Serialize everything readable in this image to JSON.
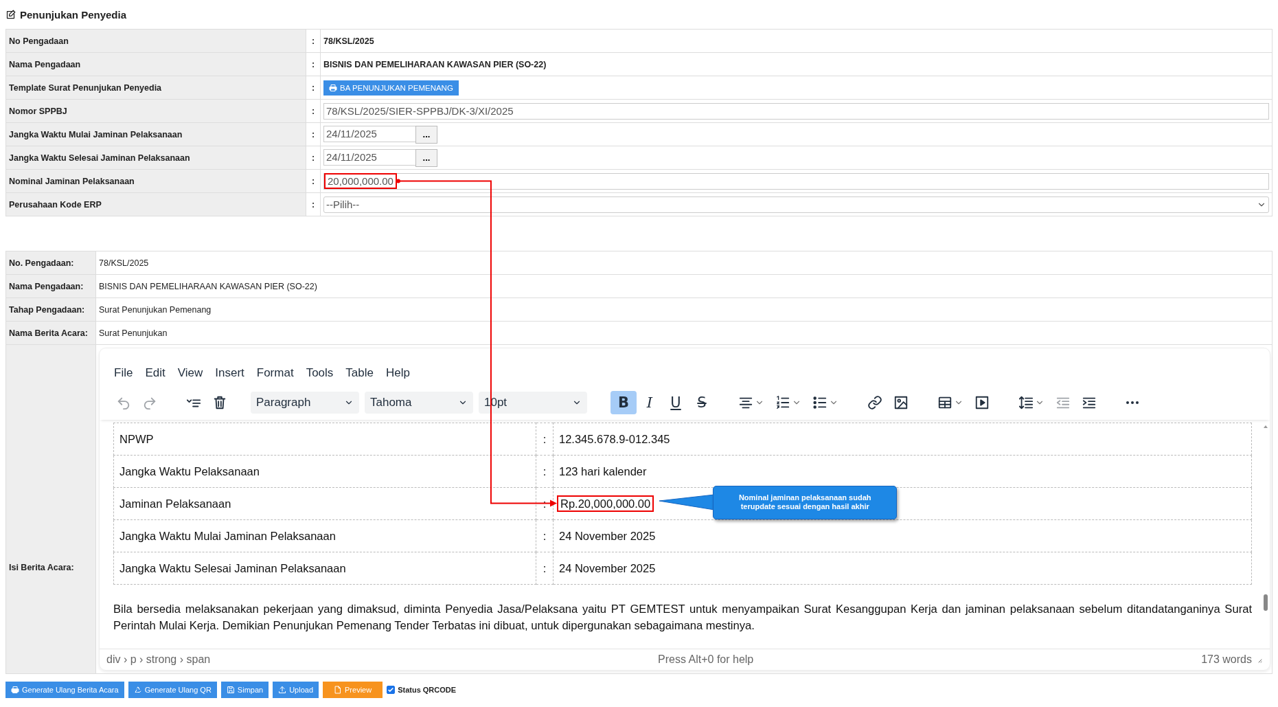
{
  "title": "Penunjukan Penyedia",
  "form": {
    "rows": [
      {
        "kind": "text",
        "label": "No Pengadaan",
        "sep": ":",
        "value": "78/KSL/2025"
      },
      {
        "kind": "text",
        "label": "Nama Pengadaan",
        "sep": ":",
        "value": "BISNIS DAN PEMELIHARAAN KAWASAN PIER (SO-22)"
      },
      {
        "kind": "button",
        "label": "Template Surat Penunjukan Penyedia",
        "sep": ":",
        "button": "BA PENUNJUKAN PEMENANG"
      },
      {
        "kind": "input",
        "label": "Nomor SPPBJ",
        "sep": ":",
        "value": "78/KSL/2025/SIER-SPPBJ/DK-3/XI/2025",
        "highlighted": false
      },
      {
        "kind": "date",
        "label": "Jangka Waktu Mulai Jaminan Pelaksanaan",
        "sep": ":",
        "value": "24/11/2025",
        "button": "..."
      },
      {
        "kind": "date",
        "label": "Jangka Waktu Selesai Jaminan Pelaksanaan",
        "sep": ":",
        "value": "24/11/2025",
        "button": "..."
      },
      {
        "kind": "input",
        "label": "Nominal Jaminan Pelaksanaan",
        "sep": ":",
        "value": "20,000,000.00",
        "highlighted": true
      },
      {
        "kind": "select",
        "label": "Perusahaan Kode ERP",
        "sep": ":",
        "value": "--Pilih--"
      }
    ]
  },
  "info": {
    "rows": [
      {
        "label": "No. Pengadaan:",
        "value": "78/KSL/2025"
      },
      {
        "label": "Nama Pengadaan:",
        "value": "BISNIS DAN PEMELIHARAAN KAWASAN PIER (SO-22)"
      },
      {
        "label": "Tahap Pengadaan:",
        "value": "Surat Penunjukan Pemenang"
      },
      {
        "label": "Nama Berita Acara:",
        "value": "Surat Penunjukan"
      }
    ],
    "editor_label": "Isi Berita Acara:"
  },
  "editor": {
    "menu": [
      "File",
      "Edit",
      "View",
      "Insert",
      "Format",
      "Tools",
      "Table",
      "Help"
    ],
    "toolbar": [
      {
        "kind": "undo",
        "disabled": true
      },
      {
        "kind": "redo",
        "disabled": true
      },
      {
        "kind": "collapse",
        "disabled": false
      },
      {
        "kind": "delete",
        "disabled": false
      },
      {
        "kind": "select",
        "value": "Paragraph"
      },
      {
        "kind": "select",
        "value": "Tahoma"
      },
      {
        "kind": "select",
        "value": "10pt"
      },
      {
        "kind": "bold",
        "label": "B",
        "selected": true
      },
      {
        "kind": "italic",
        "label": "I",
        "selected": false
      },
      {
        "kind": "underline",
        "label": "U",
        "selected": false
      },
      {
        "kind": "strike",
        "label": "S",
        "selected": false
      },
      {
        "kind": "align",
        "disabled": false
      },
      {
        "kind": "numlist",
        "disabled": false
      },
      {
        "kind": "bullist",
        "disabled": false
      },
      {
        "kind": "link",
        "disabled": false
      },
      {
        "kind": "image",
        "disabled": false
      },
      {
        "kind": "table",
        "disabled": false
      },
      {
        "kind": "media",
        "disabled": false
      },
      {
        "kind": "lineheight",
        "disabled": false
      },
      {
        "kind": "outdent",
        "disabled": true
      },
      {
        "kind": "indent",
        "disabled": false
      },
      {
        "kind": "more",
        "disabled": false
      }
    ],
    "rows": [
      {
        "label": "NPWP",
        "sep": ":",
        "value": "12.345.678.9-012.345",
        "highlighted": false
      },
      {
        "label": "Jangka Waktu Pelaksanaan",
        "sep": ":",
        "value": "123 hari kalender",
        "highlighted": false
      },
      {
        "label": "Jaminan Pelaksanaan",
        "sep": ":",
        "value": "Rp.20,000,000.00",
        "highlighted": true
      },
      {
        "label": "Jangka Waktu Mulai Jaminan Pelaksanaan",
        "sep": ":",
        "value": "24 November 2025",
        "highlighted": false
      },
      {
        "label": "Jangka Waktu Selesai Jaminan Pelaksanaan",
        "sep": ":",
        "value": "24 November 2025",
        "highlighted": false
      }
    ],
    "paragraph": "Bila bersedia melaksanakan pekerjaan yang dimaksud, diminta Penyedia Jasa/Pelaksana yaitu PT GEMTEST untuk menyampaikan Surat Kesanggupan Kerja dan jaminan pelaksanaan sebelum ditandatanganinya Surat Perintah Mulai Kerja. Demikian Penunjukan Pemenang Tender Terbatas ini dibuat, untuk dipergunakan sebagaimana mestinya.",
    "status": {
      "path": "div › p › strong › span",
      "help": "Press Alt+0 for help",
      "words": "173 words"
    }
  },
  "callout": "Nominal jaminan pelaksanaan sudah terupdate sesuai dengan hasil akhir",
  "footer": {
    "buttons": [
      {
        "kind": "print",
        "label": "Generate Ulang Berita Acara"
      },
      {
        "kind": "recycle",
        "label": "Generate Ulang QR"
      },
      {
        "kind": "save",
        "label": "Simpan"
      },
      {
        "kind": "upload",
        "label": "Upload"
      },
      {
        "kind": "preview",
        "label": "Preview"
      }
    ],
    "checkbox": {
      "label": "Status QRCODE",
      "checked": true
    }
  }
}
